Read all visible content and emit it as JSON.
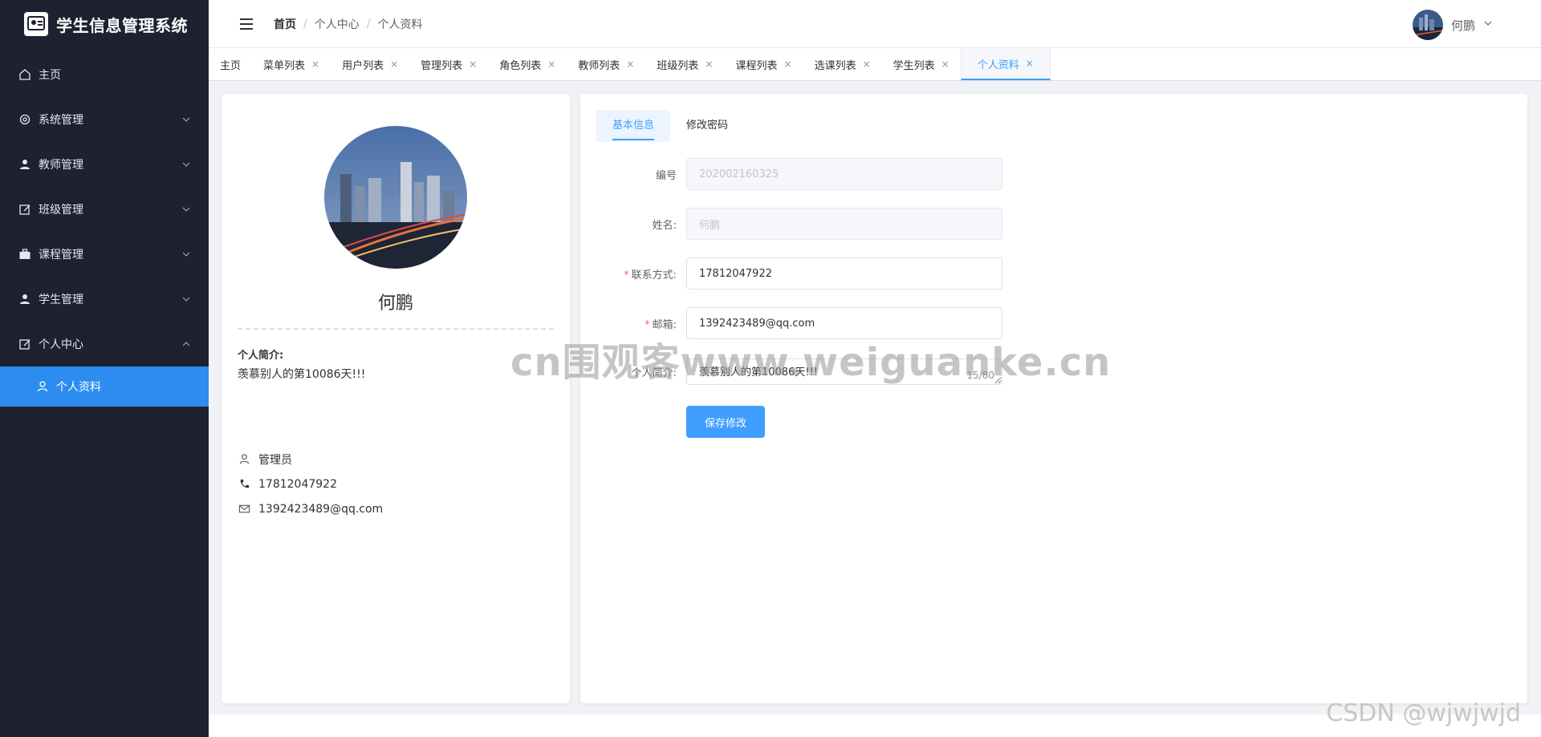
{
  "app": {
    "title": "学生信息管理系统"
  },
  "sidebar": {
    "items": [
      {
        "label": "主页",
        "icon": "home-icon"
      },
      {
        "label": "系统管理",
        "icon": "gear-icon"
      },
      {
        "label": "教师管理",
        "icon": "user-icon"
      },
      {
        "label": "班级管理",
        "icon": "edit-icon"
      },
      {
        "label": "课程管理",
        "icon": "briefcase-icon"
      },
      {
        "label": "学生管理",
        "icon": "user-icon"
      },
      {
        "label": "个人中心",
        "icon": "edit-icon"
      }
    ],
    "sub_item": {
      "label": "个人资料",
      "icon": "user-icon"
    }
  },
  "header": {
    "breadcrumb": [
      "首页",
      "个人中心",
      "个人资料"
    ],
    "user_name": "何鹏"
  },
  "tabs": [
    "主页",
    "菜单列表",
    "用户列表",
    "管理列表",
    "角色列表",
    "教师列表",
    "班级列表",
    "课程列表",
    "选课列表",
    "学生列表",
    "个人资料"
  ],
  "active_tab": "个人资料",
  "profile": {
    "name": "何鹏",
    "intro_label": "个人简介:",
    "intro_text": "羡慕别人的第10086天!!!",
    "role": "管理员",
    "phone": "17812047922",
    "email": "1392423489@qq.com"
  },
  "form": {
    "tabs": [
      "基本信息",
      "修改密码"
    ],
    "active_tab": "基本信息",
    "fields": {
      "id": {
        "label": "编号",
        "value": "202002160325"
      },
      "name": {
        "label": "姓名:",
        "value": "何鹏"
      },
      "phone": {
        "label": "联系方式:",
        "value": "17812047922"
      },
      "email": {
        "label": "邮箱:",
        "value": "1392423489@qq.com"
      },
      "intro": {
        "label": "个人简介:",
        "value": "羡慕别人的第10086天!!!",
        "counter": "15/80"
      }
    },
    "save_label": "保存修改"
  },
  "watermark": "cn围观客www.weiguanke.cn",
  "csdn": "CSDN @wjwjwjd",
  "colors": {
    "sidebar_bg": "#1e2130",
    "active_blue": "#2d8cf0",
    "primary": "#409eff"
  }
}
